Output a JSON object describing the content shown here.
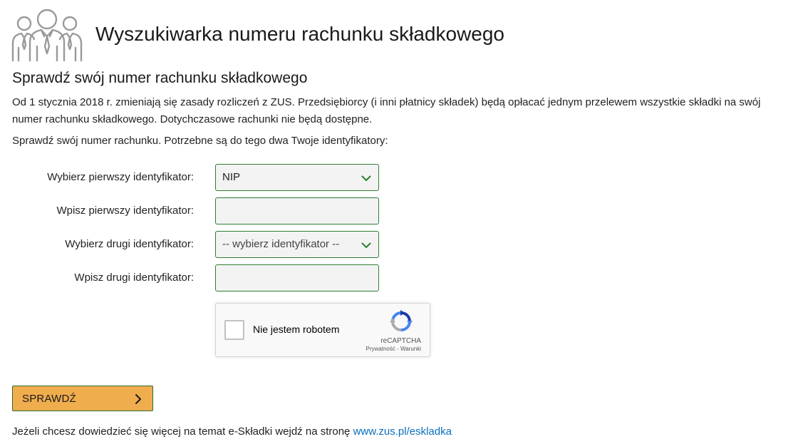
{
  "header": {
    "title": "Wyszukiwarka numeru rachunku składkowego",
    "icon": "people-group-icon"
  },
  "content": {
    "section_title": "Sprawdź swój numer rachunku składkowego",
    "intro": "Od 1 stycznia 2018 r. zmieniają się zasady rozliczeń z ZUS. Przedsiębiorcy (i inni płatnicy składek) będą opłacać jednym przelewem wszystkie składki na swój numer rachunku składkowego. Dotychczasowe rachunki nie będą dostępne.",
    "instructions": "Sprawdź swój numer rachunku. Potrzebne są do tego dwa Twoje identyfikatory:"
  },
  "form": {
    "first_id_select_label": "Wybierz pierwszy identyfikator:",
    "first_id_select_value": "NIP",
    "first_id_input_label": "Wpisz pierwszy identyfikator:",
    "first_id_input_value": "",
    "second_id_select_label": "Wybierz drugi identyfikator:",
    "second_id_select_value": "-- wybierz identyfikator --",
    "second_id_input_label": "Wpisz drugi identyfikator:",
    "second_id_input_value": ""
  },
  "captcha": {
    "label": "Nie jestem robotem",
    "brand": "reCAPTCHA",
    "links": "Prywatność - Warunki"
  },
  "submit": {
    "label": "SPRAWDŹ"
  },
  "footer": {
    "text": "Jeżeli chcesz dowiedzieć się więcej na temat e-Składki wejdź na stronę ",
    "link_text": "www.zus.pl/eskladka"
  },
  "colors": {
    "accent_green": "#2e7d32",
    "button_orange": "#f0ad4e",
    "link_blue": "#0a6ebd",
    "field_background": "#f3f3f3"
  }
}
